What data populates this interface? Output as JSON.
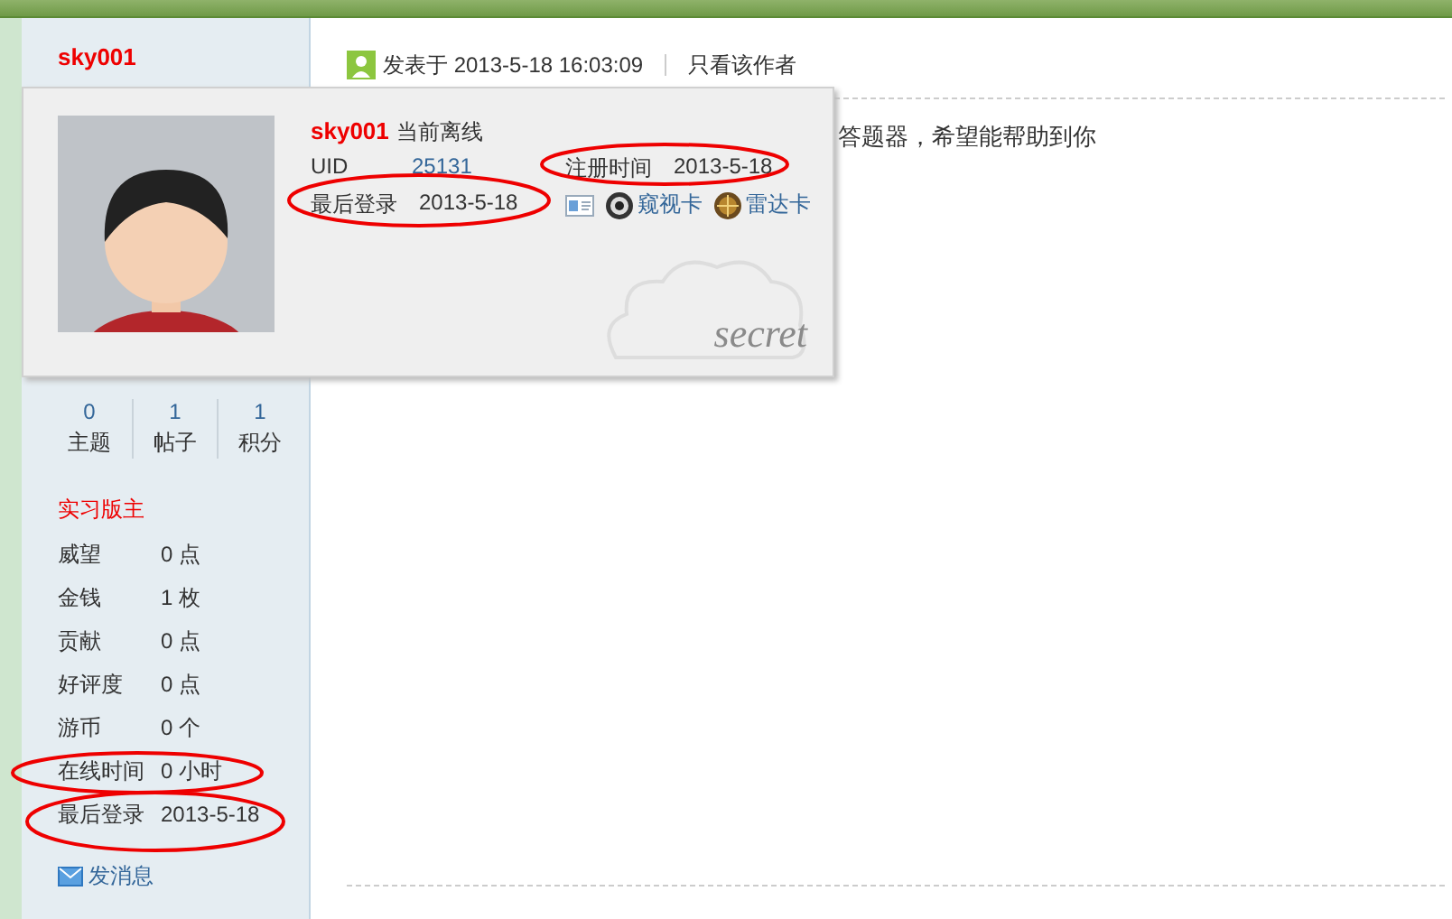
{
  "sidebar": {
    "username": "sky001",
    "stats": [
      {
        "value": "0",
        "label": "主题"
      },
      {
        "value": "1",
        "label": "帖子"
      },
      {
        "value": "1",
        "label": "积分"
      }
    ],
    "group": "实习版主",
    "fields": [
      {
        "label": "威望",
        "value": "0 点"
      },
      {
        "label": "金钱",
        "value": "1 枚"
      },
      {
        "label": "贡献",
        "value": "0 点"
      },
      {
        "label": "好评度",
        "value": "0 点"
      },
      {
        "label": "游币",
        "value": "0 个"
      },
      {
        "label": "在线时间",
        "value": "0 小时"
      },
      {
        "label": "最后登录",
        "value": "2013-5-18"
      }
    ],
    "message_link": "发消息"
  },
  "post": {
    "posted": "发表于 2013-5-18 16:03:09",
    "author_only": "只看该作者",
    "text": "答题器，希望能帮助到你"
  },
  "user_card": {
    "username": "sky001",
    "status": "当前离线",
    "uid_label": "UID",
    "uid": "25131",
    "registered_label": "注册时间",
    "registered": "2013-5-18",
    "last_login_label": "最后登录",
    "last_login": "2013-5-18",
    "actions": [
      {
        "kind": "peek",
        "label": "窥视卡"
      },
      {
        "kind": "radar",
        "label": "雷达卡"
      }
    ],
    "watermark": "secret"
  }
}
